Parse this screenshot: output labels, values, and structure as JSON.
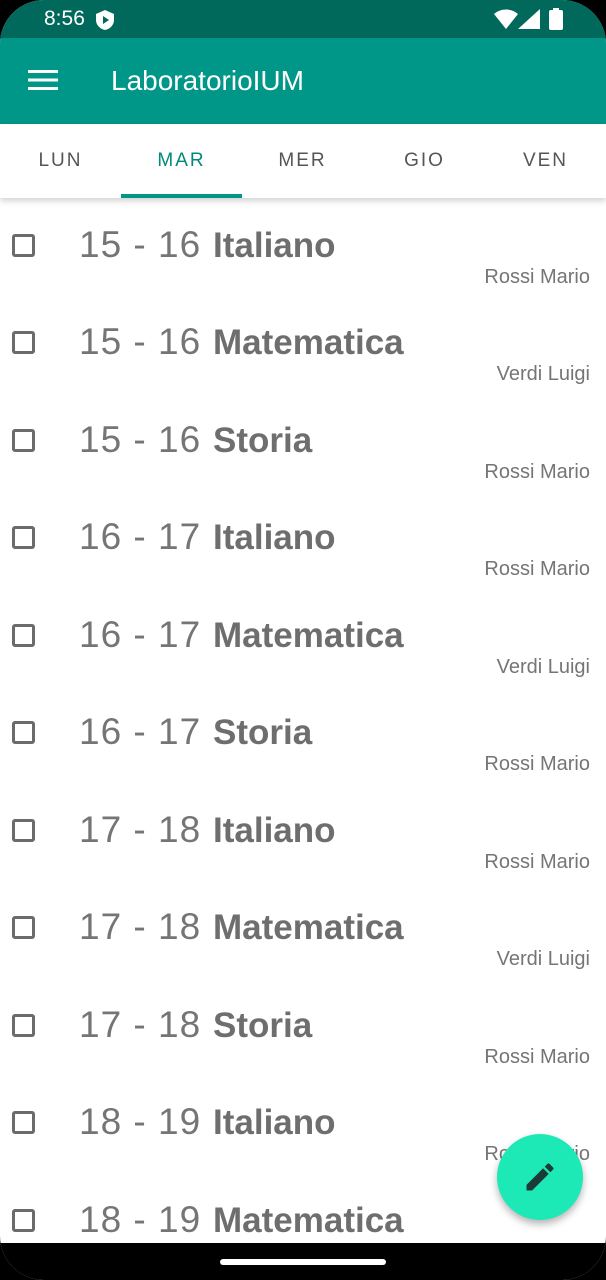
{
  "status_bar": {
    "time": "8:56"
  },
  "app_bar": {
    "title": "LaboratorioIUM"
  },
  "tabs": [
    {
      "label": "LUN",
      "active": false
    },
    {
      "label": "MAR",
      "active": true
    },
    {
      "label": "MER",
      "active": false
    },
    {
      "label": "GIO",
      "active": false
    },
    {
      "label": "VEN",
      "active": false
    }
  ],
  "lessons": [
    {
      "hours": "15-16",
      "subject": "Italiano",
      "teacher": "Rossi Mario",
      "checked": false
    },
    {
      "hours": "15-16",
      "subject": "Matematica",
      "teacher": "Verdi Luigi",
      "checked": false
    },
    {
      "hours": "15-16",
      "subject": "Storia",
      "teacher": "Rossi Mario",
      "checked": false
    },
    {
      "hours": "16-17",
      "subject": "Italiano",
      "teacher": "Rossi Mario",
      "checked": false
    },
    {
      "hours": "16-17",
      "subject": "Matematica",
      "teacher": "Verdi Luigi",
      "checked": false
    },
    {
      "hours": "16-17",
      "subject": "Storia",
      "teacher": "Rossi Mario",
      "checked": false
    },
    {
      "hours": "17-18",
      "subject": "Italiano",
      "teacher": "Rossi Mario",
      "checked": false
    },
    {
      "hours": "17-18",
      "subject": "Matematica",
      "teacher": "Verdi Luigi",
      "checked": false
    },
    {
      "hours": "17-18",
      "subject": "Storia",
      "teacher": "Rossi Mario",
      "checked": false
    },
    {
      "hours": "18-19",
      "subject": "Italiano",
      "teacher": "Rossi Mario",
      "checked": false
    },
    {
      "hours": "18-19",
      "subject": "Matematica",
      "teacher": "",
      "checked": false
    }
  ],
  "fab": {
    "icon": "pencil-icon"
  },
  "colors": {
    "primary": "#009688",
    "primary_dark": "#00695c",
    "accent": "#1de9b6"
  }
}
